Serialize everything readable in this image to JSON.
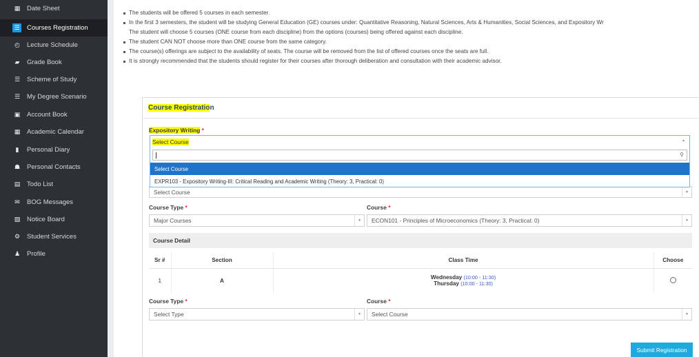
{
  "sidebar": {
    "items": [
      {
        "label": "Date Sheet",
        "icon": "calendar-icon",
        "glyph": "▦"
      },
      {
        "label": "Courses Registration",
        "icon": "list-icon",
        "glyph": "☰"
      },
      {
        "label": "Lecture Schedule",
        "icon": "clock-icon",
        "glyph": "◴"
      },
      {
        "label": "Grade Book",
        "icon": "book-icon",
        "glyph": "▰"
      },
      {
        "label": "Scheme of Study",
        "icon": "list-icon",
        "glyph": "☰"
      },
      {
        "label": "My Degree Scenario",
        "icon": "list-icon",
        "glyph": "☰"
      },
      {
        "label": "Account Book",
        "icon": "money-icon",
        "glyph": "▣"
      },
      {
        "label": "Academic Calendar",
        "icon": "calendar-icon",
        "glyph": "▦"
      },
      {
        "label": "Personal Diary",
        "icon": "diary-icon",
        "glyph": "▮"
      },
      {
        "label": "Personal Contacts",
        "icon": "users-icon",
        "glyph": "☗"
      },
      {
        "label": "Todo List",
        "icon": "list-icon",
        "glyph": "▤"
      },
      {
        "label": "BOG Messages",
        "icon": "envelope-icon",
        "glyph": "✉"
      },
      {
        "label": "Notice Board",
        "icon": "board-icon",
        "glyph": "▧"
      },
      {
        "label": "Student Services",
        "icon": "gears-icon",
        "glyph": "⚙"
      },
      {
        "label": "Profile",
        "icon": "user-icon",
        "glyph": "♟"
      }
    ]
  },
  "notes": {
    "lines": [
      "The students will be offered 5 courses in each semester.",
      "In the first 3 semesters, the student will be studying General Education (GE) courses under: Quantitative Reasoning, Natural Sciences, Arts & Humanities, Social Sciences, and Expository Wr",
      "The student will choose 5 courses (ONE course from each discipline) from the options (courses) being offered against each discipline.",
      "The student CAN NOT choose more than ONE course from the same category.",
      "The course(s) offerings are subject to the availability of seats. The course will be removed from the list of offered courses once the seats are full.",
      "It is strongly recommended that the students should register for their courses after thorough deliberation and consultation with their academic advisor."
    ]
  },
  "panel": {
    "title_hl": "Course Registratio",
    "title_rest": "n",
    "expository_label": "Expository Writing",
    "required_mark": "*",
    "dropdown": {
      "selected": "Select Course",
      "search_value": "",
      "options": [
        "Select Course",
        "EXPR103 - Expository Writing-III: Critical Reading and Academic Writing (Theory: 3, Practical: 0)"
      ]
    },
    "hidden_select_value": "Select Course",
    "row1": {
      "type_label": "Course Type",
      "type_value": "Major Courses",
      "course_label": "Course",
      "course_value": "ECON101 - Principles of Microeconomics (Theory: 3, Practical: 0)"
    },
    "course_detail": {
      "heading": "Course Detail",
      "columns": [
        "Sr #",
        "Section",
        "Class Time",
        "Choose"
      ],
      "rows": [
        {
          "sr": "1",
          "section": "A",
          "day1": "Wednesday",
          "time1": "(10:00 - 11:30)",
          "day2": "Thursday",
          "time2": "(10:00 - 11:30)"
        }
      ]
    },
    "row2": {
      "type_label": "Course Type",
      "type_placeholder": "Select Type",
      "course_label": "Course",
      "course_placeholder": "Select Course"
    },
    "submit_label": "Submit Registration"
  },
  "colors": {
    "sidebar_bg": "#2d3035",
    "active_accent": "#2196d8",
    "highlight": "#ffff00",
    "required": "#e62525",
    "dropdown_selected": "#1f74c9",
    "submit_bg": "#1fa9e1"
  }
}
